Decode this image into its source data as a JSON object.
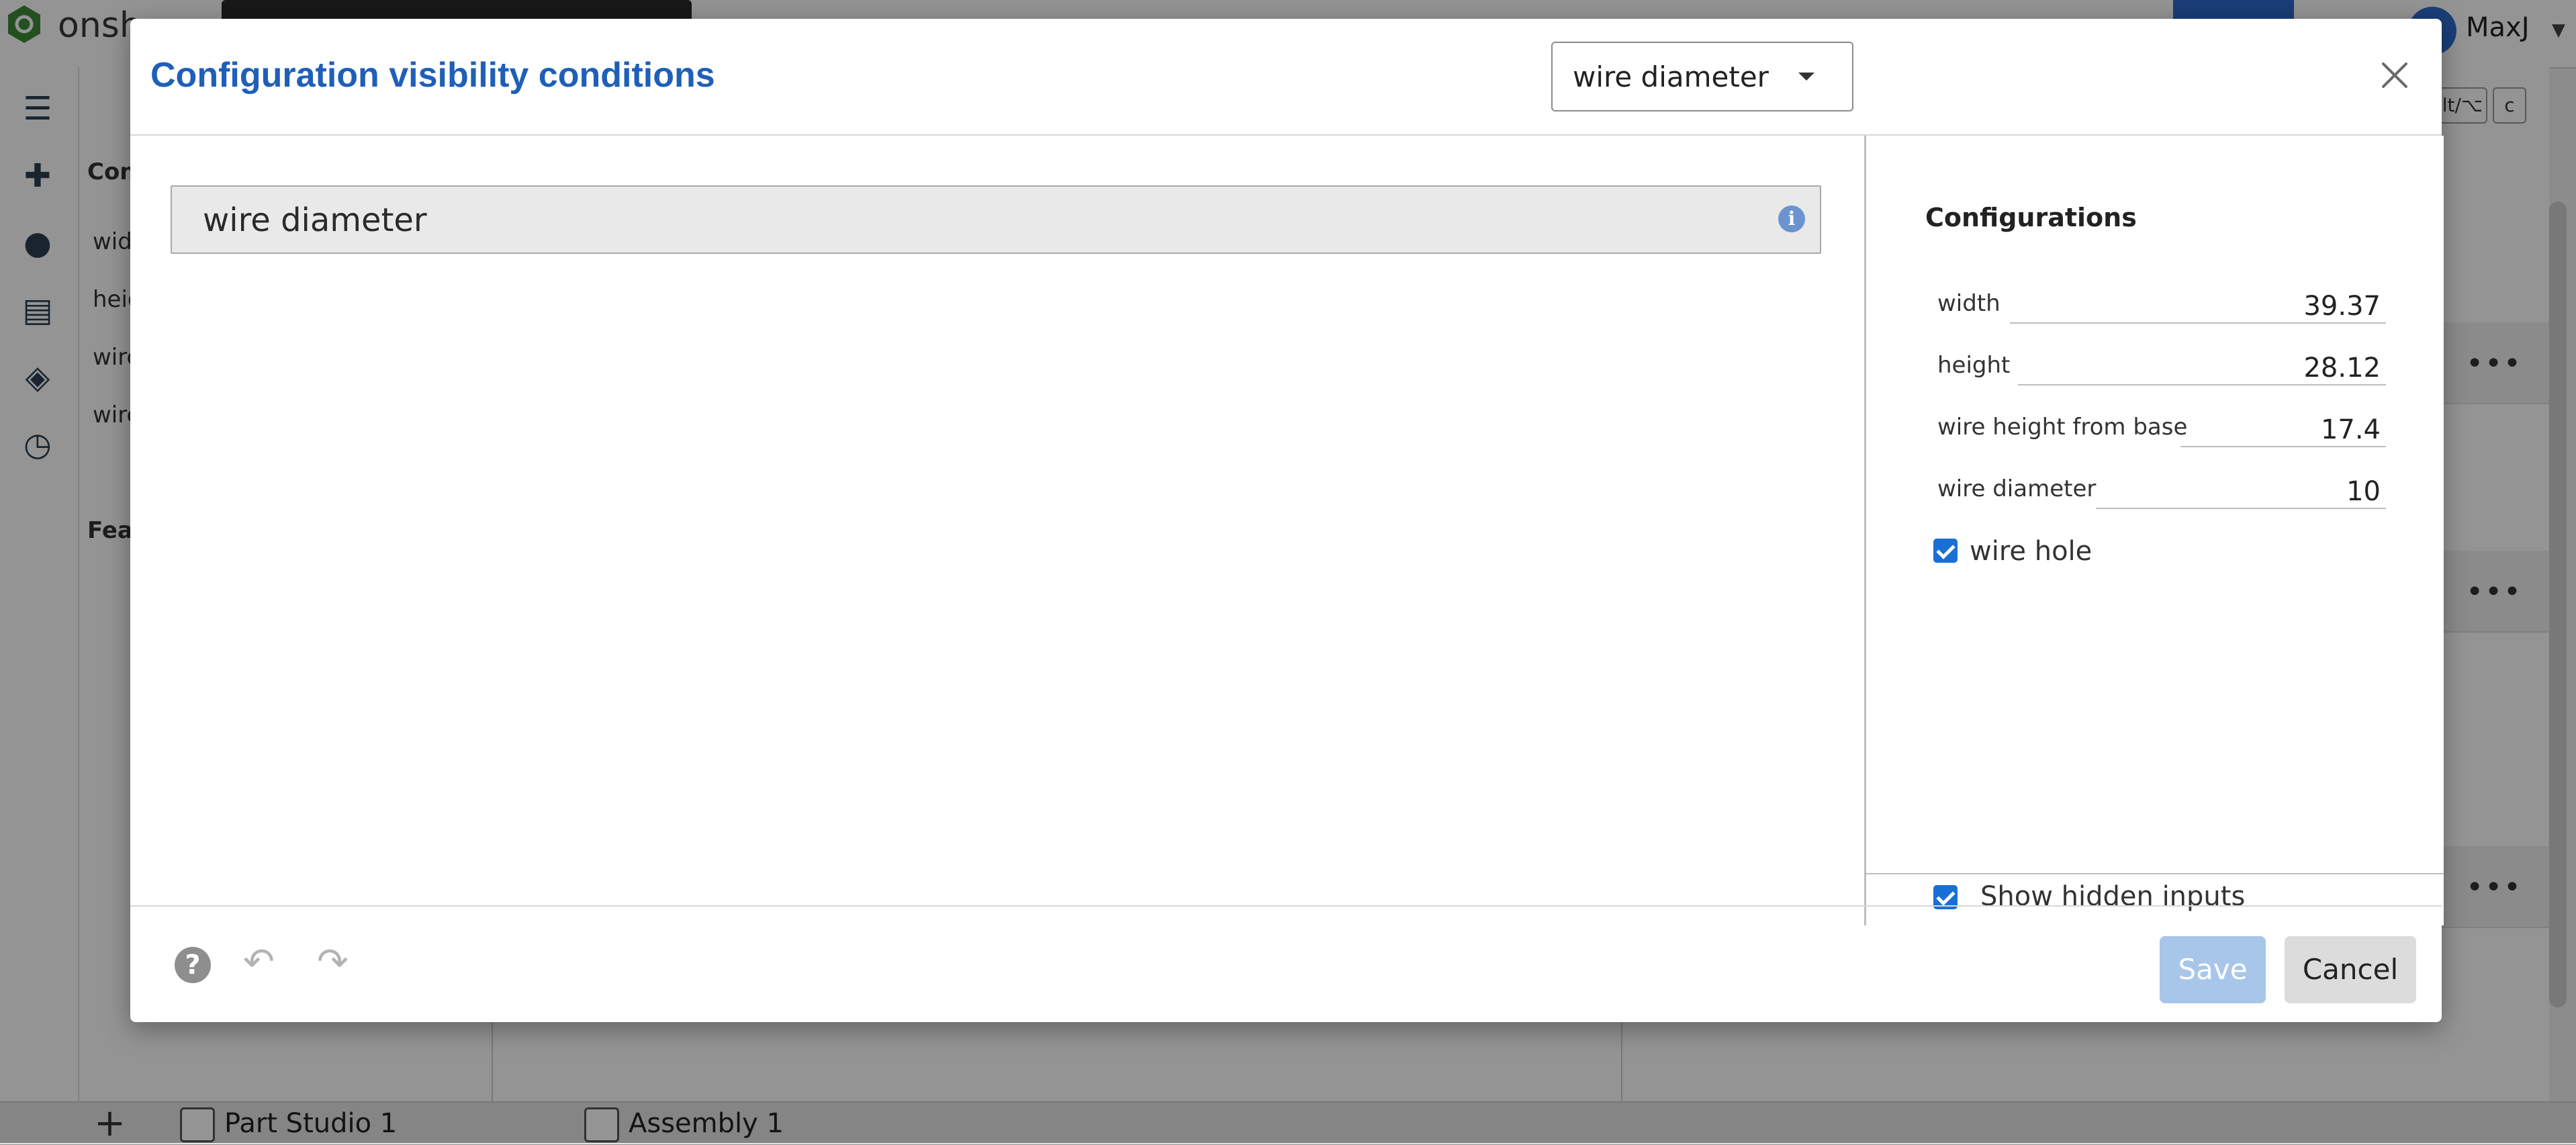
{
  "app": {
    "brand": "onsh",
    "user_name": "MaxJ",
    "feature_panel": {
      "section_short": "Con",
      "items": [
        "widt",
        "heig",
        "wire",
        "wire"
      ],
      "features_short": "Fea"
    },
    "shortcut_keys": [
      "lt/⌥",
      "c"
    ],
    "tabs": [
      {
        "label": "Part Studio 1"
      },
      {
        "label": "Assembly 1"
      }
    ]
  },
  "dialog": {
    "title": "Configuration visibility conditions",
    "selected_input": "wire diameter",
    "condition_label": "wire diameter",
    "info_icon": "i",
    "configurations": {
      "title": "Configurations",
      "rows": [
        {
          "label": "width",
          "value": "39.37"
        },
        {
          "label": "height",
          "value": "28.12"
        },
        {
          "label": "wire height from base",
          "value": "17.4"
        },
        {
          "label": "wire diameter",
          "value": "10"
        }
      ],
      "checkbox": {
        "label": "wire hole",
        "checked": true
      }
    },
    "show_hidden": {
      "label": "Show hidden inputs",
      "checked": true
    },
    "footer": {
      "help": "?",
      "undo": "↶",
      "redo": "↷",
      "save_label": "Save",
      "cancel_label": "Cancel"
    }
  },
  "colors": {
    "accent": "#1f5fb8",
    "checkbox": "#1a6fd6",
    "save_disabled": "#a7c6ea"
  }
}
